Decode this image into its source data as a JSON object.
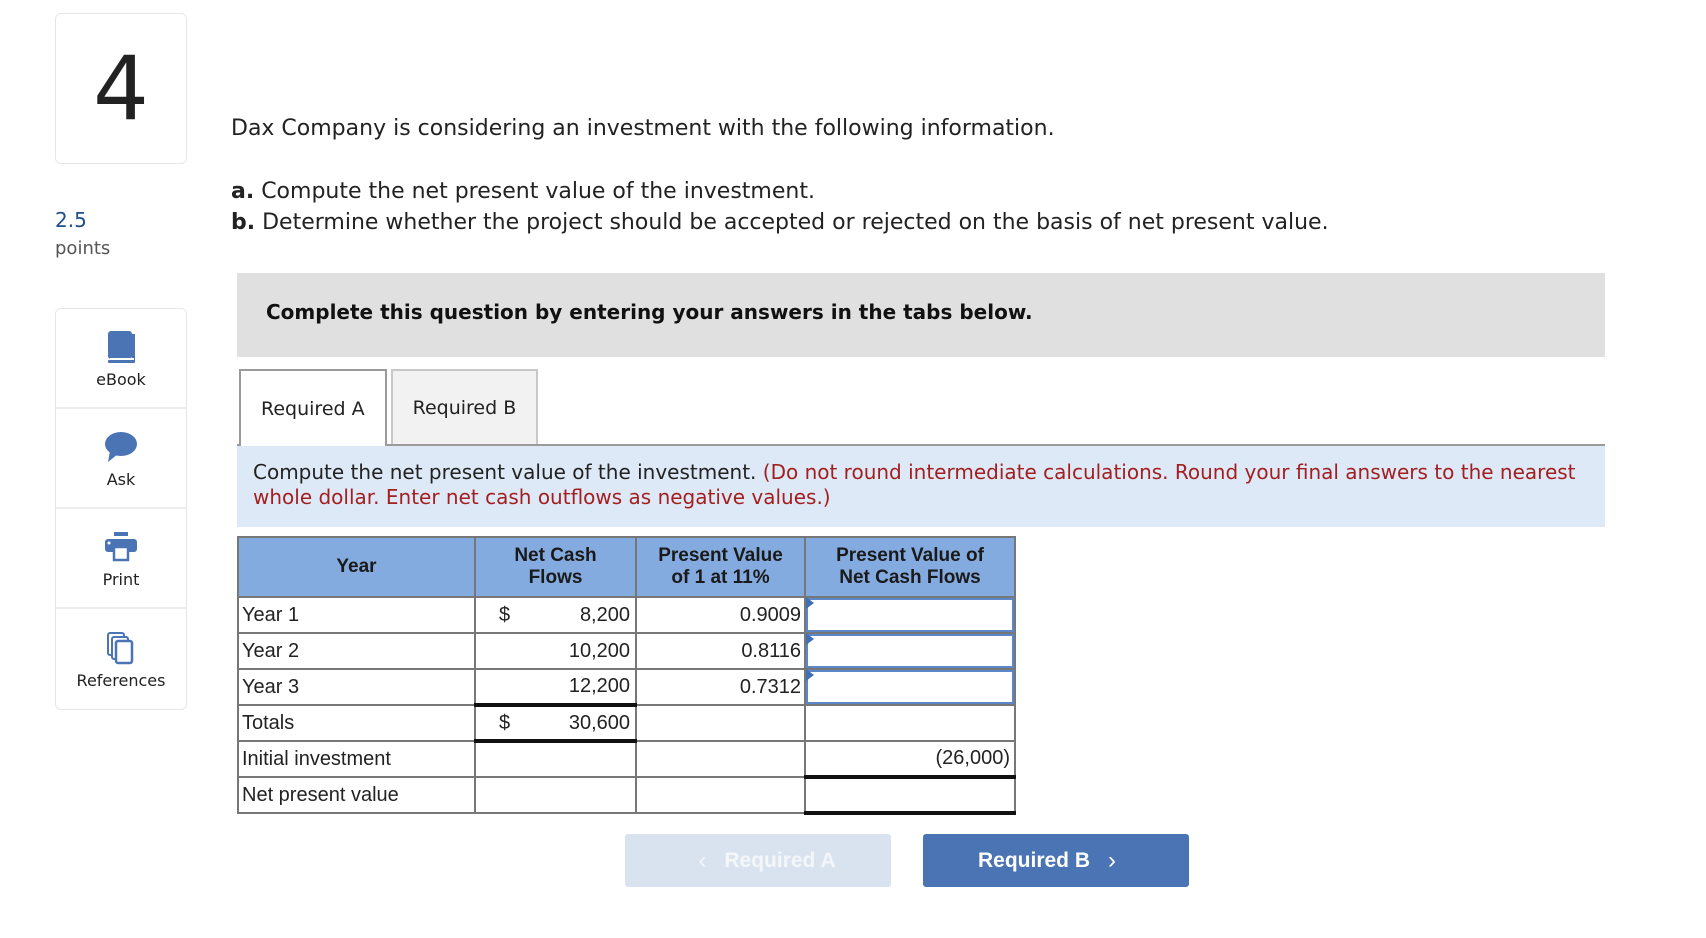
{
  "question": {
    "number": "4",
    "points_value": "2.5",
    "points_label": "points"
  },
  "tools": [
    {
      "label": "eBook",
      "icon": "book-icon"
    },
    {
      "label": "Ask",
      "icon": "speech-bubble-icon"
    },
    {
      "label": "Print",
      "icon": "printer-icon"
    },
    {
      "label": "References",
      "icon": "documents-icon"
    }
  ],
  "content": {
    "intro": "Dax Company is considering an investment with the following information.",
    "requirements": [
      {
        "letter": "a.",
        "text": " Compute the net present value of the investment."
      },
      {
        "letter": "b.",
        "text": " Determine whether the project should be accepted or rejected on the basis of net present value."
      }
    ],
    "instruction": "Complete this question by entering your answers in the tabs below."
  },
  "tabs": [
    {
      "label": "Required A",
      "active": true
    },
    {
      "label": "Required B",
      "active": false
    }
  ],
  "prompt": {
    "text": "Compute the net present value of the investment. ",
    "note": "(Do not round intermediate calculations. Round your final answers to the nearest whole dollar. Enter net cash outflows as negative values.)"
  },
  "table": {
    "headers": [
      "Year",
      "Net Cash Flows",
      "Present Value of 1 at 11%",
      "Present Value of Net Cash Flows"
    ],
    "header_lines": {
      "year": "Year",
      "ncf_1": "Net Cash",
      "ncf_2": "Flows",
      "pv_1": "Present Value",
      "pv_2": "of 1 at 11%",
      "pvn_1": "Present Value of",
      "pvn_2": "Net Cash Flows"
    },
    "rows": [
      {
        "year": "Year 1",
        "currency": "$",
        "ncf": "8,200",
        "pv_factor": "0.9009",
        "pv_ncf": ""
      },
      {
        "year": "Year 2",
        "currency": "",
        "ncf": "10,200",
        "pv_factor": "0.8116",
        "pv_ncf": ""
      },
      {
        "year": "Year 3",
        "currency": "",
        "ncf": "12,200",
        "pv_factor": "0.7312",
        "pv_ncf": ""
      }
    ],
    "totals": {
      "label": "Totals",
      "currency": "$",
      "ncf": "30,600",
      "pv_ncf": ""
    },
    "initial_investment": {
      "label": "Initial investment",
      "pv_ncf": "(26,000)"
    },
    "npv": {
      "label": "Net present value",
      "pv_ncf": ""
    }
  },
  "nav": {
    "prev_label": "Required A",
    "next_label": "Required B",
    "prev_chevron": "‹",
    "next_chevron": "›"
  },
  "colors": {
    "accent": "#4a74b4",
    "header_bg": "#84abdf",
    "prompt_bg": "#dde9f6",
    "note_red": "#a31f1f"
  }
}
